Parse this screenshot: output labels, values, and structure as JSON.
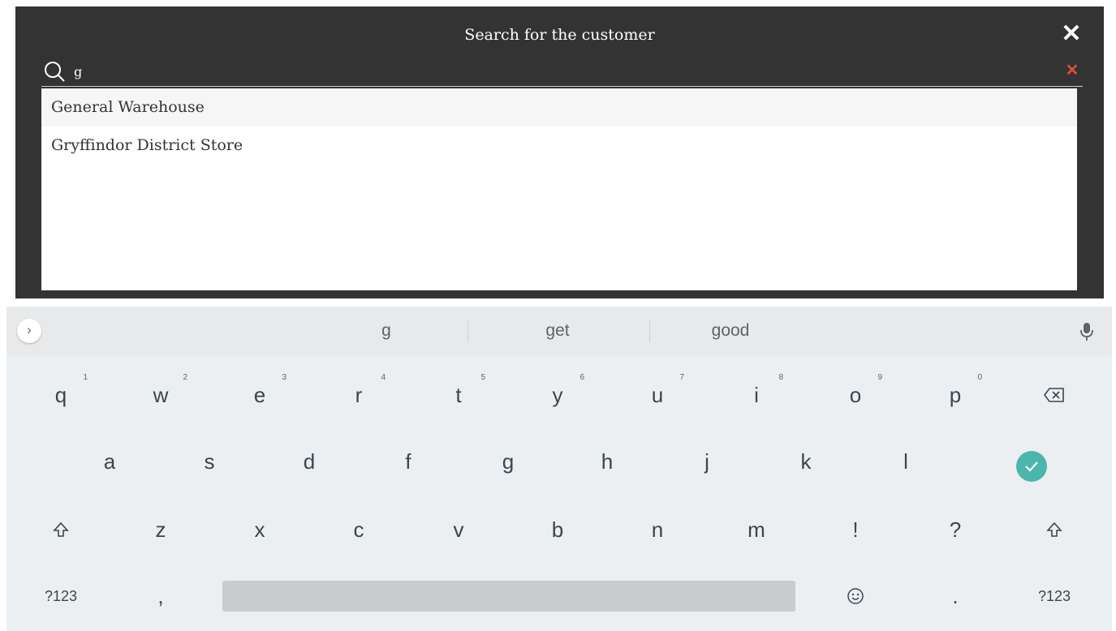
{
  "dialog": {
    "title": "Search for the customer",
    "close_icon": "close-icon",
    "search": {
      "value": "g",
      "placeholder": "",
      "icon": "search-icon",
      "clear_icon": "clear-icon",
      "clear_color": "#e34b3c"
    },
    "results": [
      "General Warehouse",
      "Gryffindor District Store"
    ],
    "colors": {
      "background": "#333333",
      "text": "#ffffff"
    }
  },
  "keyboard": {
    "suggestions": [
      "g",
      "get",
      "good"
    ],
    "expand_icon": "chevron-right-icon",
    "mic_icon": "microphone-icon",
    "row1": [
      {
        "key": "q",
        "hint": "1"
      },
      {
        "key": "w",
        "hint": "2"
      },
      {
        "key": "e",
        "hint": "3"
      },
      {
        "key": "r",
        "hint": "4"
      },
      {
        "key": "t",
        "hint": "5"
      },
      {
        "key": "y",
        "hint": "6"
      },
      {
        "key": "u",
        "hint": "7"
      },
      {
        "key": "i",
        "hint": "8"
      },
      {
        "key": "o",
        "hint": "9"
      },
      {
        "key": "p",
        "hint": "0"
      }
    ],
    "backspace_icon": "backspace-icon",
    "row2": [
      "a",
      "s",
      "d",
      "f",
      "g",
      "h",
      "j",
      "k",
      "l"
    ],
    "enter_icon": "check-icon",
    "enter_color": "#4db6ac",
    "shift_icon": "shift-icon",
    "row3": [
      "z",
      "x",
      "c",
      "v",
      "b",
      "n",
      "m",
      "!",
      "?"
    ],
    "row4": {
      "symbols_left": "?123",
      "comma": ",",
      "emoji_icon": "emoji-icon",
      "period": ".",
      "symbols_right": "?123"
    }
  }
}
